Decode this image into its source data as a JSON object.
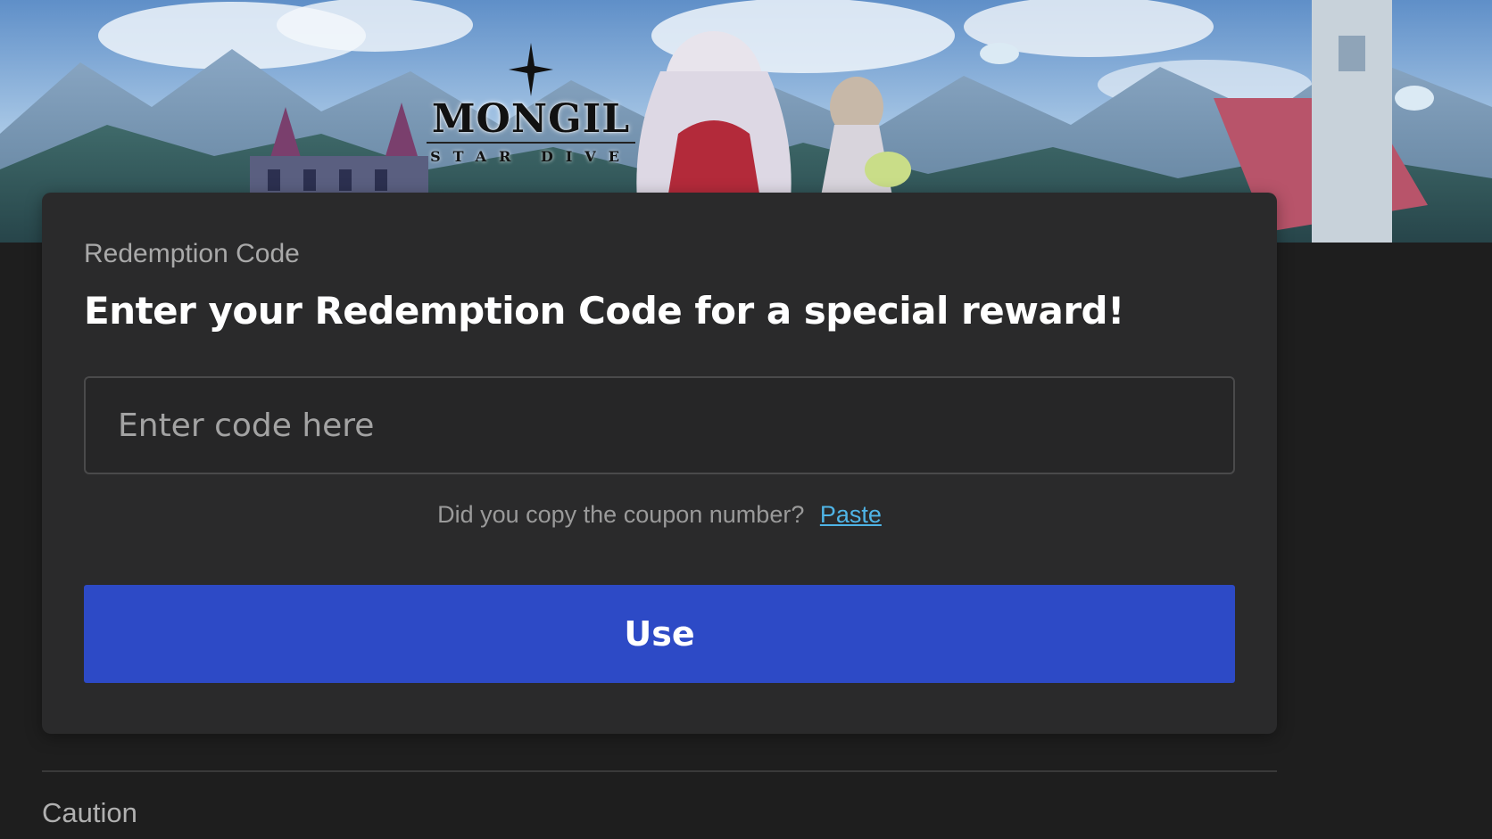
{
  "banner": {
    "logo_title": "MONGIL",
    "logo_subtitle": "STAR DIVE"
  },
  "card": {
    "label": "Redemption Code",
    "title": "Enter your Redemption Code for a special reward!",
    "code_input": {
      "placeholder": "Enter code here",
      "value": ""
    },
    "paste_prompt": "Did you copy the coupon number?",
    "paste_link": "Paste",
    "use_button": "Use"
  },
  "caution": {
    "heading": "Caution"
  },
  "colors": {
    "page_bg": "#1e1e1e",
    "card_bg": "#2a2a2b",
    "accent_button": "#2d4ac6",
    "link": "#4fb4e6"
  },
  "icons": [
    "star-sparkle-icon"
  ]
}
